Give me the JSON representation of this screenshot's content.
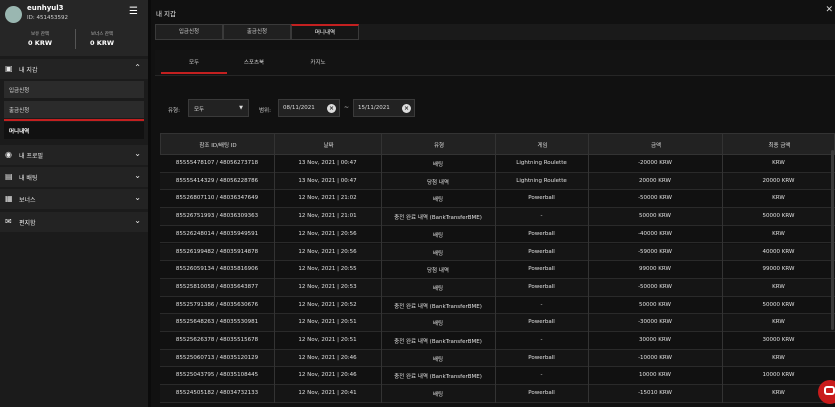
{
  "profile": {
    "username": "eunhyul3",
    "user_id": "ID: 451453592"
  },
  "balances": {
    "main_label": "보유 잔액",
    "main_value": "0 KRW",
    "bonus_label": "보너스 잔액",
    "bonus_value": "0 KRW"
  },
  "sidebar": {
    "wallet_label": "내 지갑",
    "wallet_items": [
      "입금신청",
      "출금신청",
      "머니내역"
    ],
    "promo_label": "내 프로필",
    "bet_label": "내 배팅",
    "bonus_label": "보너스",
    "message_label": "편지함"
  },
  "header": {
    "title": "내 지갑"
  },
  "tabs": [
    "입금신청",
    "출금신청",
    "머니내역"
  ],
  "subtabs": [
    "모두",
    "스포츠북",
    "카지노"
  ],
  "filters": {
    "type_label": "유형:",
    "type_value": "모두",
    "range_label": "범위:",
    "date_from": "08/11/2021",
    "date_to": "15/11/2021",
    "range_sep": "~"
  },
  "table": {
    "columns": [
      "참조 ID/배팅 ID",
      "날짜",
      "유형",
      "게임",
      "금액",
      "최종 금액"
    ],
    "rows": [
      [
        "85555478107 / 48056273718",
        "13 Nov, 2021 | 00:47",
        "배팅",
        "Lightning Roulette",
        "-20000 KRW",
        "KRW"
      ],
      [
        "85555414329 / 48056228786",
        "13 Nov, 2021 | 00:47",
        "당첨 내역",
        "Lightning Roulette",
        "20000 KRW",
        "20000 KRW"
      ],
      [
        "85526807110 / 48036347649",
        "12 Nov, 2021 | 21:02",
        "배팅",
        "Powerball",
        "-50000 KRW",
        "KRW"
      ],
      [
        "85526751993 / 48036309363",
        "12 Nov, 2021 | 21:01",
        "충전 완료 내역 (BankTransferBME)",
        "-",
        "50000 KRW",
        "50000 KRW"
      ],
      [
        "85526248014 / 48035949591",
        "12 Nov, 2021 | 20:56",
        "배팅",
        "Powerball",
        "-40000 KRW",
        "KRW"
      ],
      [
        "85526199482 / 48035914878",
        "12 Nov, 2021 | 20:56",
        "배팅",
        "Powerball",
        "-59000 KRW",
        "40000 KRW"
      ],
      [
        "85526059134 / 48035816906",
        "12 Nov, 2021 | 20:55",
        "당첨 내역",
        "Powerball",
        "99000 KRW",
        "99000 KRW"
      ],
      [
        "85525810058 / 48035643877",
        "12 Nov, 2021 | 20:53",
        "배팅",
        "Powerball",
        "-50000 KRW",
        "KRW"
      ],
      [
        "85525791386 / 48035630676",
        "12 Nov, 2021 | 20:52",
        "충전 완료 내역 (BankTransferBME)",
        "-",
        "50000 KRW",
        "50000 KRW"
      ],
      [
        "85525648263 / 48035530981",
        "12 Nov, 2021 | 20:51",
        "배팅",
        "Powerball",
        "-30000 KRW",
        "KRW"
      ],
      [
        "85525626378 / 48035515678",
        "12 Nov, 2021 | 20:51",
        "충전 완료 내역 (BankTransferBME)",
        "-",
        "30000 KRW",
        "30000 KRW"
      ],
      [
        "85525060713 / 48035120129",
        "12 Nov, 2021 | 20:46",
        "배팅",
        "Powerball",
        "-10000 KRW",
        "KRW"
      ],
      [
        "85525043795 / 48035108445",
        "12 Nov, 2021 | 20:46",
        "충전 완료 내역 (BankTransferBME)",
        "-",
        "10000 KRW",
        "10000 KRW"
      ],
      [
        "85524505182 / 48034732133",
        "12 Nov, 2021 | 20:41",
        "배팅",
        "Powerball",
        "-15010 KRW",
        "KRW"
      ]
    ]
  },
  "colors": {
    "accent": "#c32020",
    "sidebar_bg": "#1b1b1b",
    "main_bg": "#111111"
  }
}
